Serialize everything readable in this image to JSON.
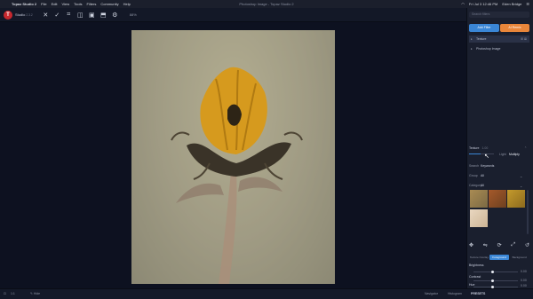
{
  "menubar": {
    "app_name": "Topaz Studio 2",
    "items": [
      "File",
      "Edit",
      "View",
      "Tools",
      "Filters",
      "Community",
      "Help"
    ],
    "window_title": "Photoshop Image - Topaz Studio 2",
    "datetime": "Fri Jul 3  12:46 PM",
    "user": "Eden Bridge"
  },
  "toolbar": {
    "studio_label": "Studio",
    "studio_sub": "2.3.2",
    "zoom": "88%"
  },
  "panel": {
    "search_placeholder": "Search filters",
    "add_filter": "Add Filter",
    "ai_remix": "AI Remix",
    "layers": [
      {
        "label": "Texture"
      },
      {
        "label": "Photoshop Image"
      }
    ],
    "texture": {
      "title": "Texture",
      "amount": "1.00",
      "opacity_percent": 45,
      "blend_light": "Light",
      "blend_mode": "Multiply"
    },
    "search_by_label": "Search",
    "search_by_value": "Keywords",
    "group_label": "Group",
    "group_value": "All",
    "category_label": "Category",
    "category_value": "All",
    "segments": [
      "Texture Overlay",
      "Foreground",
      "Background"
    ],
    "adjustments": [
      {
        "label": "Brightness",
        "value": "0.00"
      },
      {
        "label": "Contrast",
        "value": "0.00"
      },
      {
        "label": "Hue",
        "value": "0.00"
      }
    ]
  },
  "statusbar": {
    "zoom_left": "1:1",
    "hide": "Hide",
    "navigator": "Navigator",
    "histogram": "Histogram",
    "presets": "PRESETS"
  }
}
